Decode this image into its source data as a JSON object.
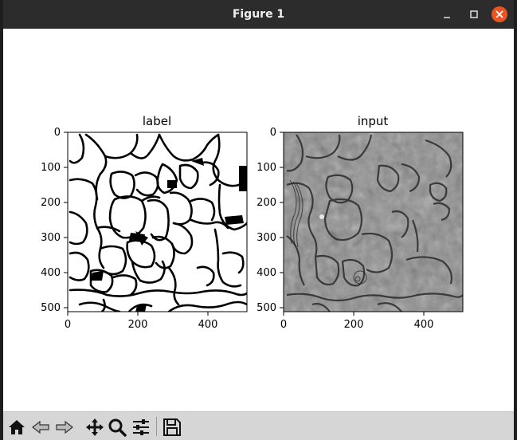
{
  "window": {
    "title": "Figure 1"
  },
  "figure": {
    "panels": [
      {
        "title": "label",
        "x_ticks": [
          "0",
          "200",
          "400"
        ],
        "y_ticks": [
          "0",
          "100",
          "200",
          "300",
          "400",
          "500"
        ]
      },
      {
        "title": "input",
        "x_ticks": [
          "0",
          "200",
          "400"
        ],
        "y_ticks": [
          "0",
          "100",
          "200",
          "300",
          "400",
          "500"
        ]
      }
    ]
  },
  "toolbar": {
    "icons": [
      "home-icon",
      "back-arrow-icon",
      "forward-arrow-icon",
      "pan-move-icon",
      "zoom-magnifier-icon",
      "configure-subplots-icon",
      "save-floppy-icon"
    ]
  },
  "colors": {
    "titlebar": "#2c2c2c",
    "close_button": "#e95420",
    "toolbar": "#d6d6d6"
  }
}
